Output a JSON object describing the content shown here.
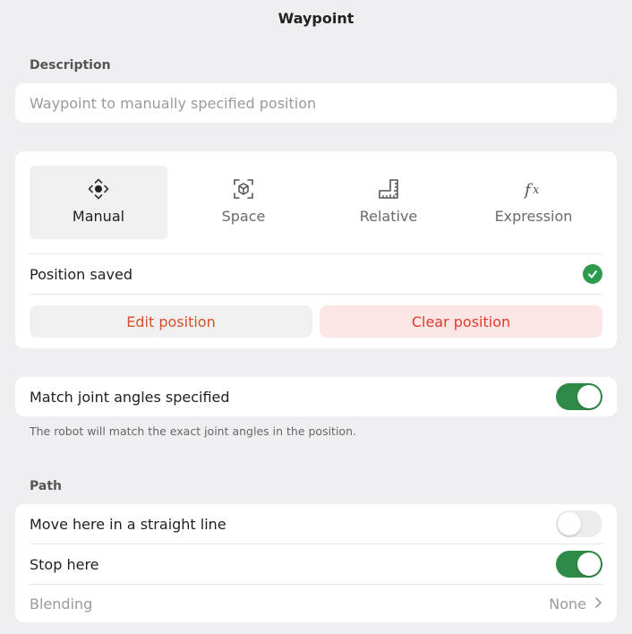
{
  "header": {
    "title": "Waypoint"
  },
  "description": {
    "label": "Description",
    "value": "",
    "placeholder": "Waypoint to manually specified position"
  },
  "modes": {
    "tabs": [
      {
        "label": "Manual",
        "icon": "move-icon",
        "active": true
      },
      {
        "label": "Space",
        "icon": "space-icon",
        "active": false
      },
      {
        "label": "Relative",
        "icon": "ruler-icon",
        "active": false
      },
      {
        "label": "Expression",
        "icon": "function-icon",
        "active": false
      }
    ],
    "status_text": "Position saved",
    "status_icon": "check-icon",
    "edit_label": "Edit position",
    "clear_label": "Clear position"
  },
  "joint": {
    "label": "Match joint angles specified",
    "enabled": true,
    "hint": "The robot will match the exact joint angles in the position."
  },
  "path": {
    "label": "Path",
    "straight_label": "Move here in a straight line",
    "straight_enabled": false,
    "stop_label": "Stop here",
    "stop_enabled": true,
    "blending_label": "Blending",
    "blending_value": "None"
  },
  "colors": {
    "accent_green": "#2e8a47",
    "edit_text": "#d4502a",
    "clear_text": "#e23b2e",
    "clear_bg": "#fbe6e5",
    "background": "#efeff1"
  }
}
